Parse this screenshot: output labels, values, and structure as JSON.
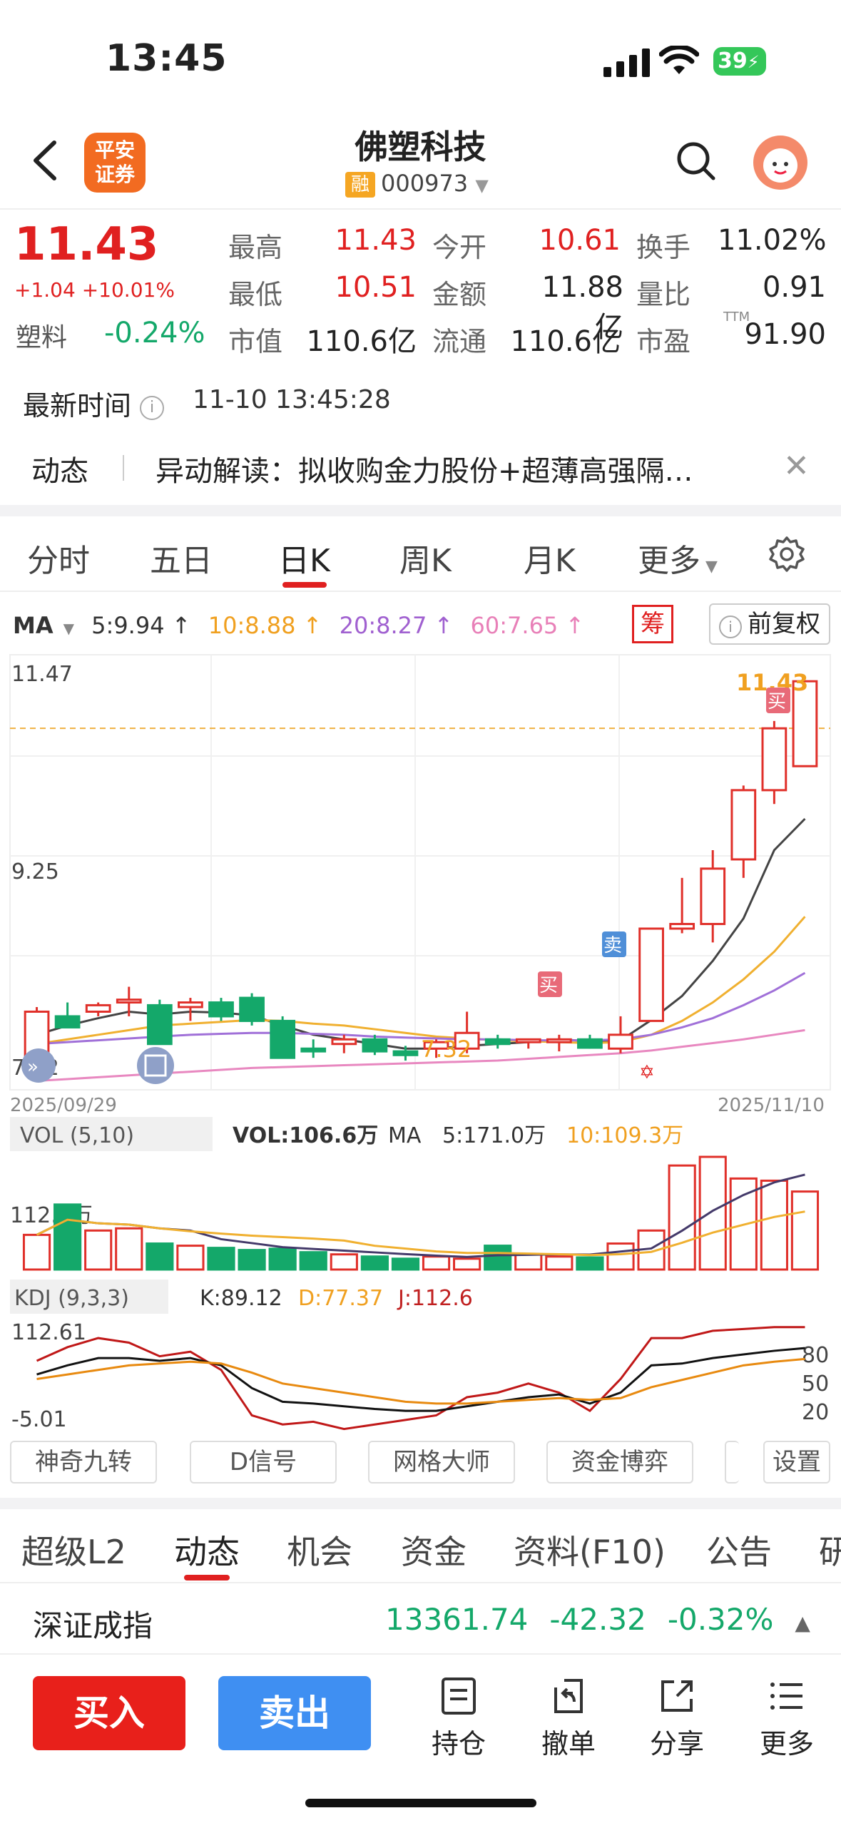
{
  "status_bar": {
    "time": "13:45",
    "battery": "39"
  },
  "header": {
    "broker_logo": "平安\n证券",
    "stock_name": "佛塑科技",
    "rong_badge": "融",
    "stock_code": "000973"
  },
  "quote": {
    "price": "11.43",
    "change": "+1.04 +10.01%",
    "sector_name": "塑料",
    "sector_change": "-0.24%",
    "fields": [
      {
        "label": "最高",
        "value": "11.43",
        "color": "#e02020"
      },
      {
        "label": "今开",
        "value": "10.61",
        "color": "#e02020"
      },
      {
        "label": "换手",
        "value": "11.02%",
        "color": "#222222"
      },
      {
        "label": "最低",
        "value": "10.51",
        "color": "#e02020"
      },
      {
        "label": "金额",
        "value": "11.88亿",
        "color": "#222222"
      },
      {
        "label": "量比",
        "value": "0.91",
        "color": "#222222"
      },
      {
        "label": "市值",
        "value": "110.6亿",
        "color": "#222222"
      },
      {
        "label": "流通",
        "value": "110.6亿",
        "color": "#222222"
      },
      {
        "label": "市盈",
        "value": "91.90",
        "color": "#222222"
      }
    ],
    "pe_superscript": "TTM"
  },
  "latest": {
    "label": "最新时间",
    "time": "11-10 13:45:28"
  },
  "news": {
    "tag": "动态",
    "text": "异动解读：拟收购金力股份+超薄高强隔…"
  },
  "chart_tabs": [
    "分时",
    "五日",
    "日K",
    "周K",
    "月K",
    "更多"
  ],
  "ma_legend": {
    "prefix": "MA",
    "items": [
      {
        "text": "5:9.94",
        "color": "#333333"
      },
      {
        "text": "10:8.88",
        "color": "#f0a020"
      },
      {
        "text": "20:8.27",
        "color": "#a060d0"
      },
      {
        "text": "60:7.65",
        "color": "#e880b8"
      }
    ],
    "chou": "筹",
    "fuquan": "前复权"
  },
  "chart_data": {
    "type": "candlestick",
    "y_top_label": "11.47",
    "y_mid_label": "9.25",
    "y_low_label": "7.22",
    "x_start": "2025/09/29",
    "x_end": "2025/11/10",
    "min_label": "7.32",
    "max_label": "11.43",
    "buy_tag": "买",
    "sell_tag": "卖",
    "ohlc": [
      [
        7.3,
        7.9,
        7.25,
        7.85
      ],
      [
        7.8,
        7.95,
        7.7,
        7.68
      ],
      [
        7.85,
        7.95,
        7.8,
        7.92
      ],
      [
        7.95,
        8.12,
        7.8,
        7.98
      ],
      [
        7.92,
        7.98,
        7.5,
        7.5
      ],
      [
        7.9,
        8.0,
        7.75,
        7.95
      ],
      [
        7.95,
        8.0,
        7.75,
        7.8
      ],
      [
        8.0,
        8.05,
        7.7,
        7.75
      ],
      [
        7.75,
        7.8,
        7.35,
        7.35
      ],
      [
        7.45,
        7.55,
        7.35,
        7.42
      ],
      [
        7.5,
        7.6,
        7.4,
        7.55
      ],
      [
        7.55,
        7.6,
        7.38,
        7.42
      ],
      [
        7.42,
        7.48,
        7.32,
        7.38
      ],
      [
        7.45,
        7.55,
        7.35,
        7.52
      ],
      [
        7.45,
        7.85,
        7.4,
        7.62
      ],
      [
        7.55,
        7.6,
        7.45,
        7.5
      ],
      [
        7.52,
        7.55,
        7.45,
        7.55
      ],
      [
        7.52,
        7.6,
        7.42,
        7.55
      ],
      [
        7.55,
        7.6,
        7.45,
        7.46
      ],
      [
        7.45,
        7.8,
        7.4,
        7.6
      ],
      [
        7.75,
        8.75,
        7.75,
        8.75
      ],
      [
        8.75,
        9.3,
        8.7,
        8.8
      ],
      [
        8.8,
        9.6,
        8.6,
        9.4
      ],
      [
        9.5,
        10.3,
        9.3,
        10.25
      ],
      [
        10.25,
        11.0,
        10.1,
        10.92
      ],
      [
        10.51,
        11.43,
        10.51,
        11.43
      ]
    ],
    "ma5": [
      7.6,
      7.7,
      7.78,
      7.85,
      7.82,
      7.85,
      7.84,
      7.81,
      7.7,
      7.6,
      7.55,
      7.5,
      7.45,
      7.45,
      7.48,
      7.5,
      7.52,
      7.55,
      7.53,
      7.54,
      7.76,
      8.02,
      8.4,
      8.86,
      9.6,
      9.94
    ],
    "ma10": [
      7.5,
      7.55,
      7.6,
      7.65,
      7.7,
      7.72,
      7.74,
      7.76,
      7.75,
      7.72,
      7.7,
      7.66,
      7.62,
      7.58,
      7.56,
      7.54,
      7.53,
      7.52,
      7.51,
      7.52,
      7.6,
      7.75,
      7.95,
      8.2,
      8.5,
      8.88
    ],
    "ma20": [
      7.5,
      7.52,
      7.54,
      7.56,
      7.58,
      7.6,
      7.61,
      7.62,
      7.62,
      7.61,
      7.6,
      7.58,
      7.57,
      7.56,
      7.55,
      7.55,
      7.54,
      7.54,
      7.54,
      7.55,
      7.6,
      7.68,
      7.78,
      7.92,
      8.08,
      8.27
    ],
    "ma60": [
      7.1,
      7.12,
      7.14,
      7.16,
      7.18,
      7.2,
      7.22,
      7.24,
      7.25,
      7.26,
      7.27,
      7.28,
      7.29,
      7.3,
      7.31,
      7.32,
      7.34,
      7.36,
      7.38,
      7.4,
      7.43,
      7.47,
      7.51,
      7.55,
      7.6,
      7.65
    ],
    "volume": {
      "legend_label": "VOL (5,10)",
      "vol_text": "VOL:106.6万",
      "ma_label": "MA",
      "ma5_text": "5:171.0万",
      "ma10_text": "10:109.3万",
      "y_label": "112.0万",
      "values": [
        80,
        150,
        90,
        95,
        60,
        55,
        50,
        45,
        48,
        40,
        35,
        30,
        25,
        30,
        25,
        55,
        35,
        30,
        28,
        60,
        90,
        240,
        260,
        210,
        205,
        180
      ]
    },
    "kdj": {
      "legend_label": "KDJ (9,3,3)",
      "k_text": "K:89.12",
      "d_text": "D:77.37",
      "j_text": "J:112.6",
      "y_top": "112.61",
      "y_bottom": "-5.01",
      "levels": [
        "80",
        "50",
        "20"
      ],
      "k": [
        60,
        70,
        78,
        78,
        75,
        78,
        70,
        45,
        30,
        28,
        25,
        22,
        20,
        20,
        25,
        30,
        35,
        38,
        28,
        40,
        70,
        72,
        78,
        82,
        86,
        89
      ],
      "d": [
        55,
        60,
        65,
        70,
        72,
        74,
        72,
        62,
        50,
        45,
        40,
        35,
        30,
        28,
        28,
        30,
        32,
        34,
        32,
        34,
        46,
        54,
        62,
        70,
        74,
        77
      ],
      "j": [
        75,
        90,
        100,
        95,
        80,
        85,
        65,
        15,
        5,
        8,
        0,
        5,
        10,
        15,
        35,
        40,
        50,
        40,
        20,
        55,
        100,
        100,
        108,
        110,
        112,
        112
      ]
    }
  },
  "indicator_buttons": [
    "神奇九转",
    "D信号",
    "网格大师",
    "资金博弈",
    "设置"
  ],
  "bottom_tabs": [
    "超级L2",
    "动态",
    "机会",
    "资金",
    "资料(F10)",
    "公告",
    "研"
  ],
  "index_row": {
    "name": "深证成指",
    "value": "13361.74",
    "change": "-42.32",
    "pct": "-0.32%"
  },
  "actions": {
    "buy": "买入",
    "sell": "卖出",
    "items": [
      "持仓",
      "撤单",
      "分享",
      "更多"
    ]
  }
}
